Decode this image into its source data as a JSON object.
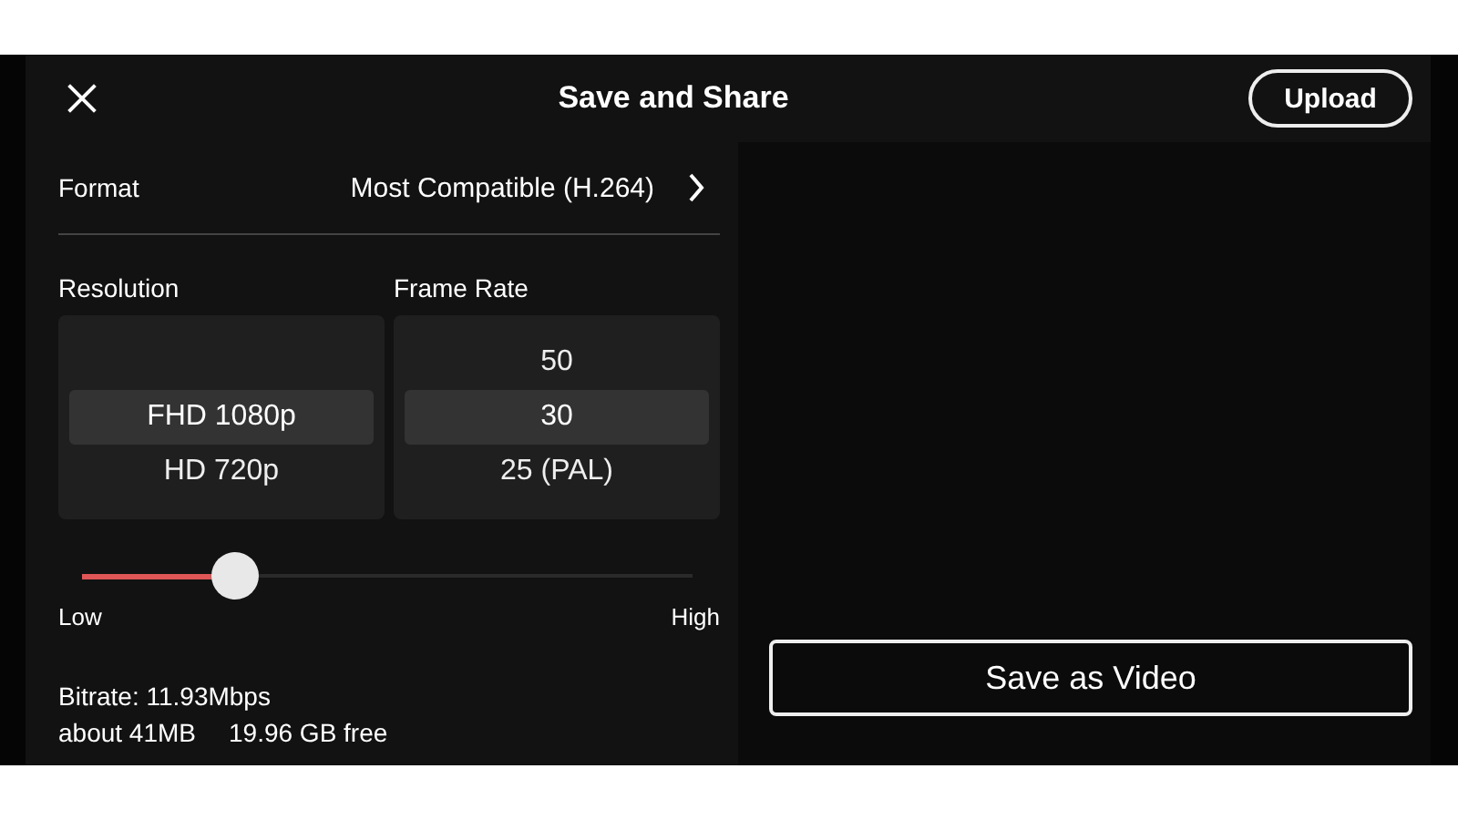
{
  "header": {
    "title": "Save and Share",
    "upload_button": "Upload"
  },
  "format": {
    "label": "Format",
    "value": "Most Compatible (H.264)"
  },
  "pickers": [
    {
      "label": "Resolution",
      "options": [
        {
          "label": "FHD 1080p",
          "selected": true
        },
        {
          "label": "HD 720p",
          "selected": false
        }
      ]
    },
    {
      "label": "Frame Rate",
      "options": [
        {
          "label": "50",
          "selected": false
        },
        {
          "label": "30",
          "selected": true
        },
        {
          "label": "25 (PAL)",
          "selected": false
        }
      ]
    }
  ],
  "quality_slider": {
    "level": 0.25,
    "min_label": "Low",
    "max_label": "High"
  },
  "bitrate": "Bitrate: 11.93Mbps",
  "size": "about 41MB",
  "free": "19.96 GB free",
  "save_button": "Save as Video"
}
